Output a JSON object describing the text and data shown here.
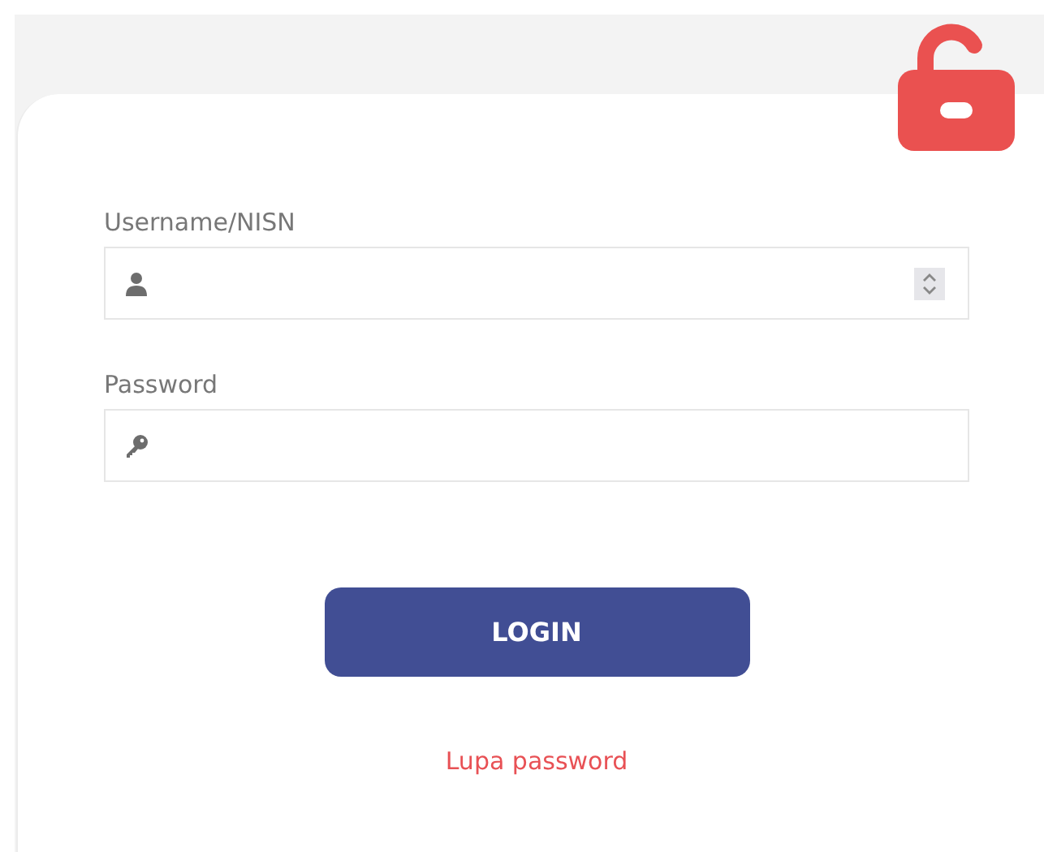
{
  "form": {
    "fields": [
      {
        "label": "Username/NISN",
        "kind": "number"
      },
      {
        "label": "Password",
        "kind": "password"
      }
    ],
    "login_button": "LOGIN",
    "forgot_link": "Lupa password"
  }
}
